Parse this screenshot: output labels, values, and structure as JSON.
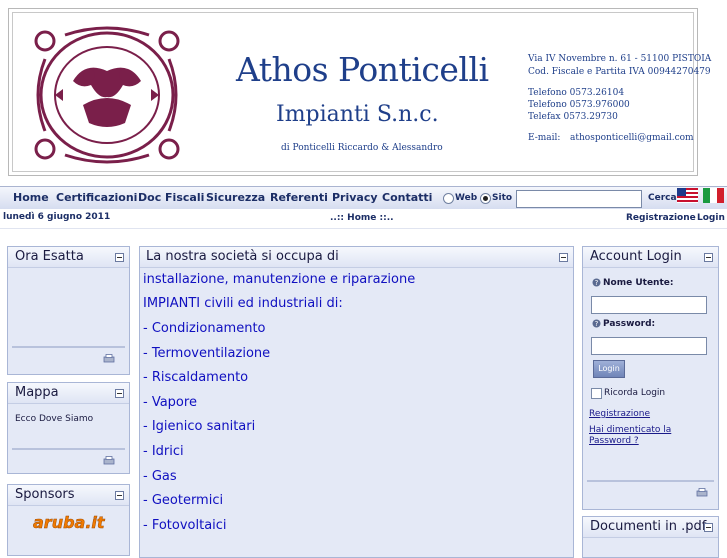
{
  "header": {
    "company_name": "Athos Ponticelli",
    "company_type": "Impianti S.n.c.",
    "owners": "di Ponticelli Riccardo & Alessandro",
    "address": "Via IV Novembre n. 61 - 51100 PISTOIA",
    "tax": "Cod. Fiscale e Partita IVA 00944270479",
    "phone1": "Telefono  0573.26104",
    "phone2": "Telefono  0573.976000",
    "fax": "Telefax    0573.29730",
    "email_label": "E-mail:",
    "email": "athosponticelli@gmail.com"
  },
  "nav": {
    "items": [
      "Home",
      "Certificazioni",
      "Doc Fiscali",
      "Sicurezza",
      "Referenti",
      "Privacy",
      "Contatti"
    ],
    "radio_web": "Web",
    "radio_site": "Sito",
    "search_value": "",
    "search_button": "Cerca"
  },
  "subbar": {
    "date": "lunedì 6 giugno 2011",
    "breadcrumb": "..:: Home ::..",
    "register": "Registrazione",
    "login": "Login"
  },
  "left": {
    "clock_title": "Ora Esatta",
    "map_title": "Mappa",
    "map_text": "Ecco Dove Siamo",
    "sponsors_title": "Sponsors",
    "sponsor_logo": "aruba.it"
  },
  "main": {
    "title": "La nostra società si occupa di",
    "lines": [
      "installazione, manutenzione e riparazione",
      "IMPIANTI civili ed industriali di:",
      "- Condizionamento",
      "- Termoventilazione",
      "- Riscaldamento",
      "- Vapore",
      "- Igienico sanitari",
      "- Idrici",
      "- Gas",
      "- Geotermici",
      "- Fotovoltaici"
    ]
  },
  "login": {
    "title": "Account Login",
    "username_label": "Nome Utente:",
    "password_label": "Password:",
    "username_value": "",
    "password_value": "",
    "login_button": "Login",
    "remember": "Ricorda Login",
    "register_link": "Registrazione",
    "forgot_link_1": "Hai dimenticato la",
    "forgot_link_2": "Password ?"
  },
  "docs": {
    "title": "Documenti in .pdf"
  },
  "colors": {
    "accent": "#1c2e66",
    "text_blue": "#1010c0",
    "panel": "#e4e9f6",
    "logo": "#7a1f4a"
  }
}
